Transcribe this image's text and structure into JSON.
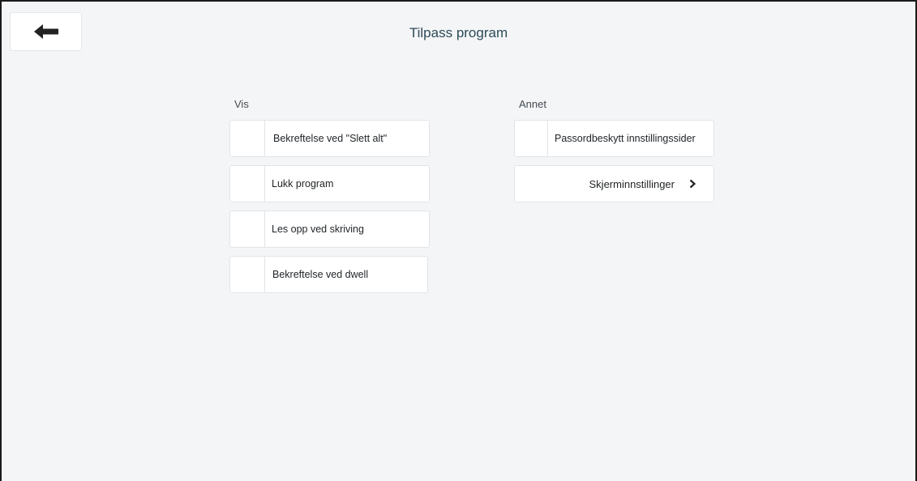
{
  "header": {
    "title": "Tilpass program",
    "back_icon": "arrow-left-icon"
  },
  "vis": {
    "heading": "Vis",
    "options": [
      {
        "label": "Bekreftelse ved \"Slett alt\"",
        "checked": false
      },
      {
        "label": "Lukk program",
        "checked": false
      },
      {
        "label": "Les opp ved skriving",
        "checked": false
      },
      {
        "label": "Bekreftelse ved dwell",
        "checked": false
      }
    ]
  },
  "annet": {
    "heading": "Annet",
    "options": [
      {
        "label": "Passordbeskytt innstillingssider",
        "checked": false
      }
    ],
    "screen_settings": {
      "label": "Skjerminnstillinger",
      "icon": "chevron-right-icon"
    }
  }
}
